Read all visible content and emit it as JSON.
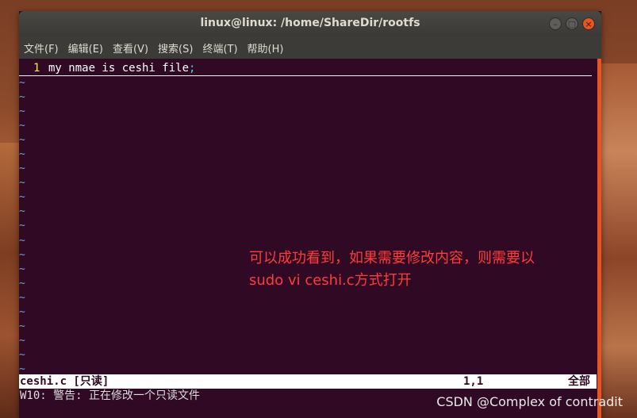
{
  "window": {
    "title": "linux@linux: /home/ShareDir/rootfs",
    "controls": {
      "minimize": "–",
      "maximize": "□",
      "close": "×"
    }
  },
  "menu": {
    "items": [
      "文件(F)",
      "编辑(E)",
      "查看(V)",
      "搜索(S)",
      "终端(T)",
      "帮助(H)"
    ]
  },
  "editor": {
    "line_number": "1",
    "line_text": "my nmae is ceshi file",
    "cursor_char": ";",
    "tilde": "~"
  },
  "annotation": {
    "line1": "可以成功看到，如果需要修改内容，则需要以",
    "line2": "sudo vi ceshi.c方式打开"
  },
  "status": {
    "file": "ceshi.c [只读]",
    "position": "1,1",
    "percent": "全部"
  },
  "message": "W10: 警告: 正在修改一个只读文件",
  "watermark": "CSDN @Complex of contradit",
  "colors": {
    "terminal_bg": "#300a24",
    "accent": "#e95420",
    "annotation": "#ff3b3b",
    "tilde": "#729fcf",
    "line_number": "#fce94f"
  }
}
